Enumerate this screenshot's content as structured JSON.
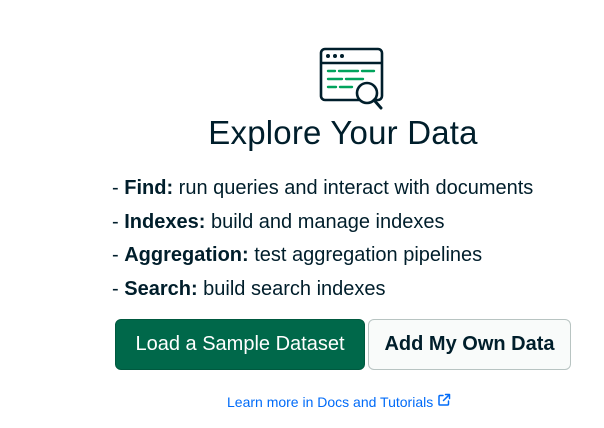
{
  "empty_state": {
    "icon": "document-search-icon",
    "title": "Explore Your Data",
    "features": [
      {
        "name": "Find:",
        "description": "run queries and interact with documents"
      },
      {
        "name": "Indexes:",
        "description": "build and manage indexes"
      },
      {
        "name": "Aggregation:",
        "description": "test aggregation pipelines"
      },
      {
        "name": "Search:",
        "description": "build search indexes"
      }
    ],
    "bullet": "-",
    "primary_button": "Load a Sample Dataset",
    "secondary_button": "Add My Own Data",
    "docs_link": "Learn more in Docs and Tutorials",
    "docs_link_icon": "external-link-icon"
  },
  "colors": {
    "primary": "#00684a",
    "text": "#001e2b",
    "link": "#016bf8",
    "icon_green": "#00a35c"
  }
}
